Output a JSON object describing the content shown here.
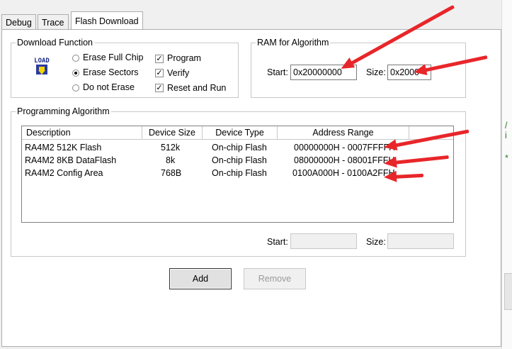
{
  "tabs": [
    {
      "label": "Debug"
    },
    {
      "label": "Trace"
    },
    {
      "label": "Flash Download"
    }
  ],
  "download_function": {
    "title": "Download Function",
    "load_icon_text": "LOAD",
    "erase_options": [
      {
        "label": "Erase Full Chip",
        "selected": false
      },
      {
        "label": "Erase Sectors",
        "selected": true
      },
      {
        "label": "Do not Erase",
        "selected": false
      }
    ],
    "checkboxes": [
      {
        "label": "Program",
        "checked": true
      },
      {
        "label": "Verify",
        "checked": true
      },
      {
        "label": "Reset and Run",
        "checked": true
      }
    ]
  },
  "ram_for_algorithm": {
    "title": "RAM for Algorithm",
    "start_label": "Start:",
    "start_value": "0x20000000",
    "size_label": "Size:",
    "size_value": "0x2000"
  },
  "programming_algorithm": {
    "title": "Programming Algorithm",
    "columns": [
      "Description",
      "Device Size",
      "Device Type",
      "Address Range"
    ],
    "rows": [
      {
        "description": "RA4M2 512K Flash",
        "size": "512k",
        "type": "On-chip Flash",
        "range": "00000000H - 0007FFFFH"
      },
      {
        "description": "RA4M2 8KB DataFlash",
        "size": "8k",
        "type": "On-chip Flash",
        "range": "08000000H - 08001FFFH"
      },
      {
        "description": "RA4M2 Config Area",
        "size": "768B",
        "type": "On-chip Flash",
        "range": "0100A000H - 0100A2FFH"
      }
    ],
    "start_label": "Start:",
    "start_value": "",
    "size_label": "Size:",
    "size_value": ""
  },
  "buttons": {
    "add": "Add",
    "remove": "Remove"
  },
  "edge_glyphs": {
    "g1": "/",
    "g2": "i",
    "g3": "*"
  },
  "colors": {
    "annotation_arrow": "#e8262a"
  }
}
